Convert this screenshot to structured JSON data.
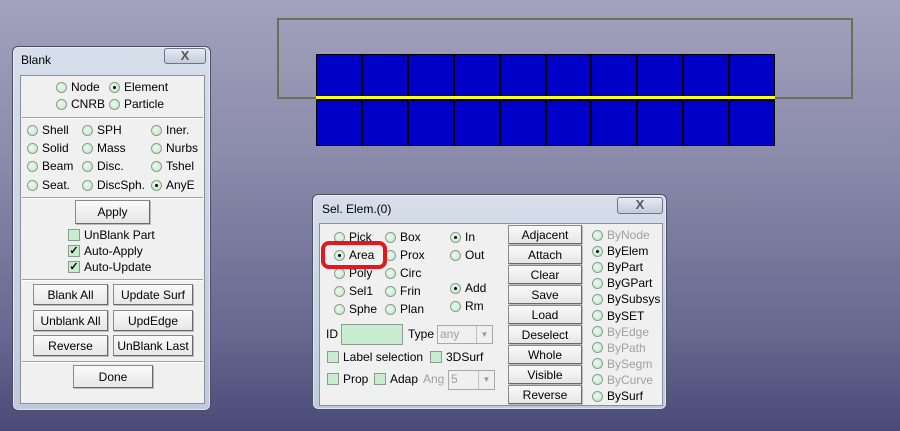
{
  "viewport": {
    "element_color": "#0000c8",
    "edge_highlight": "#ffff00",
    "columns": 10,
    "rows": 2
  },
  "blank": {
    "title": "Blank",
    "close": "X",
    "target": [
      {
        "label": "Node",
        "on": false
      },
      {
        "label": "Element",
        "on": true
      },
      {
        "label": "CNRB",
        "on": false
      },
      {
        "label": "Particle",
        "on": false
      }
    ],
    "types": [
      {
        "label": "Shell",
        "on": false
      },
      {
        "label": "SPH",
        "on": false
      },
      {
        "label": "Iner.",
        "on": false
      },
      {
        "label": "Solid",
        "on": false
      },
      {
        "label": "Mass",
        "on": false
      },
      {
        "label": "Nurbs",
        "on": false
      },
      {
        "label": "Beam",
        "on": false
      },
      {
        "label": "Disc.",
        "on": false
      },
      {
        "label": "Tshel",
        "on": false
      },
      {
        "label": "Seat.",
        "on": false
      },
      {
        "label": "DiscSph.",
        "on": false
      },
      {
        "label": "AnyE",
        "on": true
      }
    ],
    "apply": "Apply",
    "checks": [
      {
        "label": "UnBlank Part",
        "checked": false
      },
      {
        "label": "Auto-Apply",
        "checked": true
      },
      {
        "label": "Auto-Update",
        "checked": true
      }
    ],
    "buttons": [
      "Blank All",
      "Update Surf",
      "Unblank All",
      "UpdEdge",
      "Reverse",
      "UnBlank Last"
    ],
    "done": "Done"
  },
  "sel": {
    "title": "Sel. Elem.(0)",
    "close": "X",
    "modes": [
      {
        "label": "Pick",
        "on": false
      },
      {
        "label": "Box",
        "on": false
      },
      {
        "label": "Area",
        "on": true
      },
      {
        "label": "Prox",
        "on": false
      },
      {
        "label": "Poly",
        "on": false
      },
      {
        "label": "Circ",
        "on": false
      },
      {
        "label": "Sel1",
        "on": false
      },
      {
        "label": "Frin",
        "on": false
      },
      {
        "label": "Sphe",
        "on": false
      },
      {
        "label": "Plan",
        "on": false
      }
    ],
    "inout": [
      {
        "label": "In",
        "on": true
      },
      {
        "label": "Out",
        "on": false
      }
    ],
    "addrm": [
      {
        "label": "Add",
        "on": true
      },
      {
        "label": "Rm",
        "on": false
      }
    ],
    "id_label": "ID",
    "id_value": "",
    "type_label": "Type",
    "type_value": "any",
    "label_selection": "Label selection",
    "surf3d": "3DSurf",
    "prop": "Prop",
    "adap": "Adap",
    "ang_label": "Ang",
    "ang_value": "5",
    "buttons": [
      "Adjacent",
      "Attach",
      "Clear",
      "Save",
      "Load",
      "Deselect",
      "Whole",
      "Visible",
      "Reverse"
    ],
    "by": [
      {
        "label": "ByNode",
        "on": false,
        "disabled": true
      },
      {
        "label": "ByElem",
        "on": true,
        "disabled": false
      },
      {
        "label": "ByPart",
        "on": false,
        "disabled": false
      },
      {
        "label": "ByGPart",
        "on": false,
        "disabled": false
      },
      {
        "label": "BySubsys",
        "on": false,
        "disabled": false
      },
      {
        "label": "BySET",
        "on": false,
        "disabled": false
      },
      {
        "label": "ByEdge",
        "on": false,
        "disabled": true
      },
      {
        "label": "ByPath",
        "on": false,
        "disabled": true
      },
      {
        "label": "BySegm",
        "on": false,
        "disabled": true
      },
      {
        "label": "ByCurve",
        "on": false,
        "disabled": true
      },
      {
        "label": "BySurf",
        "on": false,
        "disabled": false
      }
    ],
    "highlight_color": "#e01820"
  }
}
